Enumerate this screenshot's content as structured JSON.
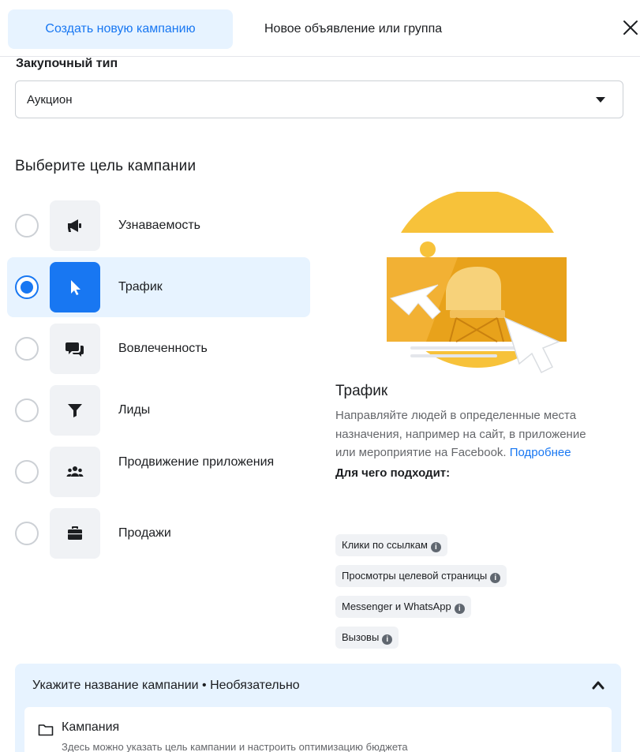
{
  "tabs": {
    "create": "Создать новую кампанию",
    "existing": "Новое объявление или группа"
  },
  "buying": {
    "label": "Закупочный тип",
    "value": "Аукцион"
  },
  "goal": {
    "title": "Выберите цель кампании",
    "options": [
      {
        "label": "Узнаваемость",
        "icon": "megaphone-icon",
        "selected": false
      },
      {
        "label": "Трафик",
        "icon": "cursor-icon",
        "selected": true
      },
      {
        "label": "Вовлеченность",
        "icon": "chat-bubbles-icon",
        "selected": false
      },
      {
        "label": "Лиды",
        "icon": "funnel-icon",
        "selected": false
      },
      {
        "label": "Продвижение приложения",
        "icon": "people-icon",
        "selected": false
      },
      {
        "label": "Продажи",
        "icon": "briefcase-icon",
        "selected": false
      }
    ]
  },
  "detail": {
    "title": "Трафик",
    "description": "Направляйте людей в определенные места назначения, например на сайт, в приложение или мероприятие на Facebook.",
    "link": "Подробнее",
    "suitable_label": "Для чего подходит:",
    "chips": [
      "Клики по ссылкам",
      "Просмотры целевой страницы",
      "Messenger и WhatsApp",
      "Вызовы"
    ]
  },
  "name_section": {
    "header": "Укажите название кампании • Необязательно",
    "campaign_label": "Кампания",
    "campaign_sub": "Здесь можно указать цель кампании и настроить оптимизацию бюджета"
  },
  "colors": {
    "accent": "#1877f2",
    "selected_bg": "#e7f3ff",
    "illustration_yellow": "#f7c23a",
    "illustration_orange": "#e8a21b"
  }
}
